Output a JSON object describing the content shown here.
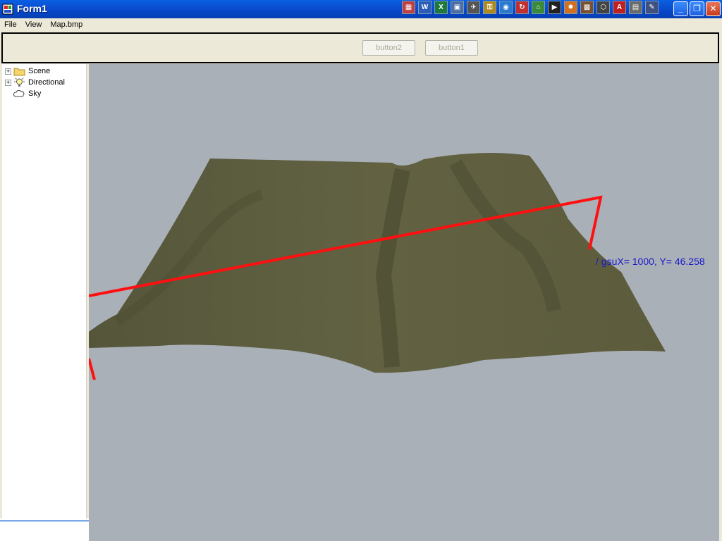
{
  "window": {
    "title": "Form1"
  },
  "tray_icons": [
    {
      "name": "palette-icon",
      "glyph": "▦",
      "color": "#c04040"
    },
    {
      "name": "word-icon",
      "glyph": "W",
      "color": "#2b5cb8"
    },
    {
      "name": "excel-icon",
      "glyph": "X",
      "color": "#1e7a3c"
    },
    {
      "name": "monitor-icon",
      "glyph": "▣",
      "color": "#4a6fa5"
    },
    {
      "name": "satellite-icon",
      "glyph": "✈",
      "color": "#555555"
    },
    {
      "name": "key-icon",
      "glyph": "⚿",
      "color": "#b08a20"
    },
    {
      "name": "globe-icon",
      "glyph": "◉",
      "color": "#2a7ad0"
    },
    {
      "name": "refresh-icon",
      "glyph": "↻",
      "color": "#c03030"
    },
    {
      "name": "network-icon",
      "glyph": "⌂",
      "color": "#3a8a3a"
    },
    {
      "name": "console-icon",
      "glyph": "▶",
      "color": "#222222"
    },
    {
      "name": "flame-icon",
      "glyph": "✹",
      "color": "#d07020"
    },
    {
      "name": "map-icon",
      "glyph": "▩",
      "color": "#7a5030"
    },
    {
      "name": "cube-icon",
      "glyph": "⬡",
      "color": "#444444"
    },
    {
      "name": "pdf-icon",
      "glyph": "A",
      "color": "#c02020"
    },
    {
      "name": "window-icon",
      "glyph": "▤",
      "color": "#6a6a6a"
    },
    {
      "name": "edit-icon",
      "glyph": "✎",
      "color": "#405080"
    }
  ],
  "menu": {
    "file": "File",
    "view": "View",
    "map": "Map.bmp"
  },
  "toolbar": {
    "button2": "button2",
    "button1": "button1"
  },
  "tree": {
    "items": [
      {
        "label": "Scene",
        "icon": "folder-icon",
        "expandable": true
      },
      {
        "label": "Directional",
        "icon": "light-bulb-icon",
        "expandable": true
      },
      {
        "label": "Sky",
        "icon": "cloud-icon",
        "expandable": false
      }
    ]
  },
  "viewport": {
    "readout": "/ gsuX= 1000, Y= 46.258",
    "terrain_color": "#5f5f3f",
    "line_color": "#ff1010",
    "background_color": "#a9b0b8"
  }
}
